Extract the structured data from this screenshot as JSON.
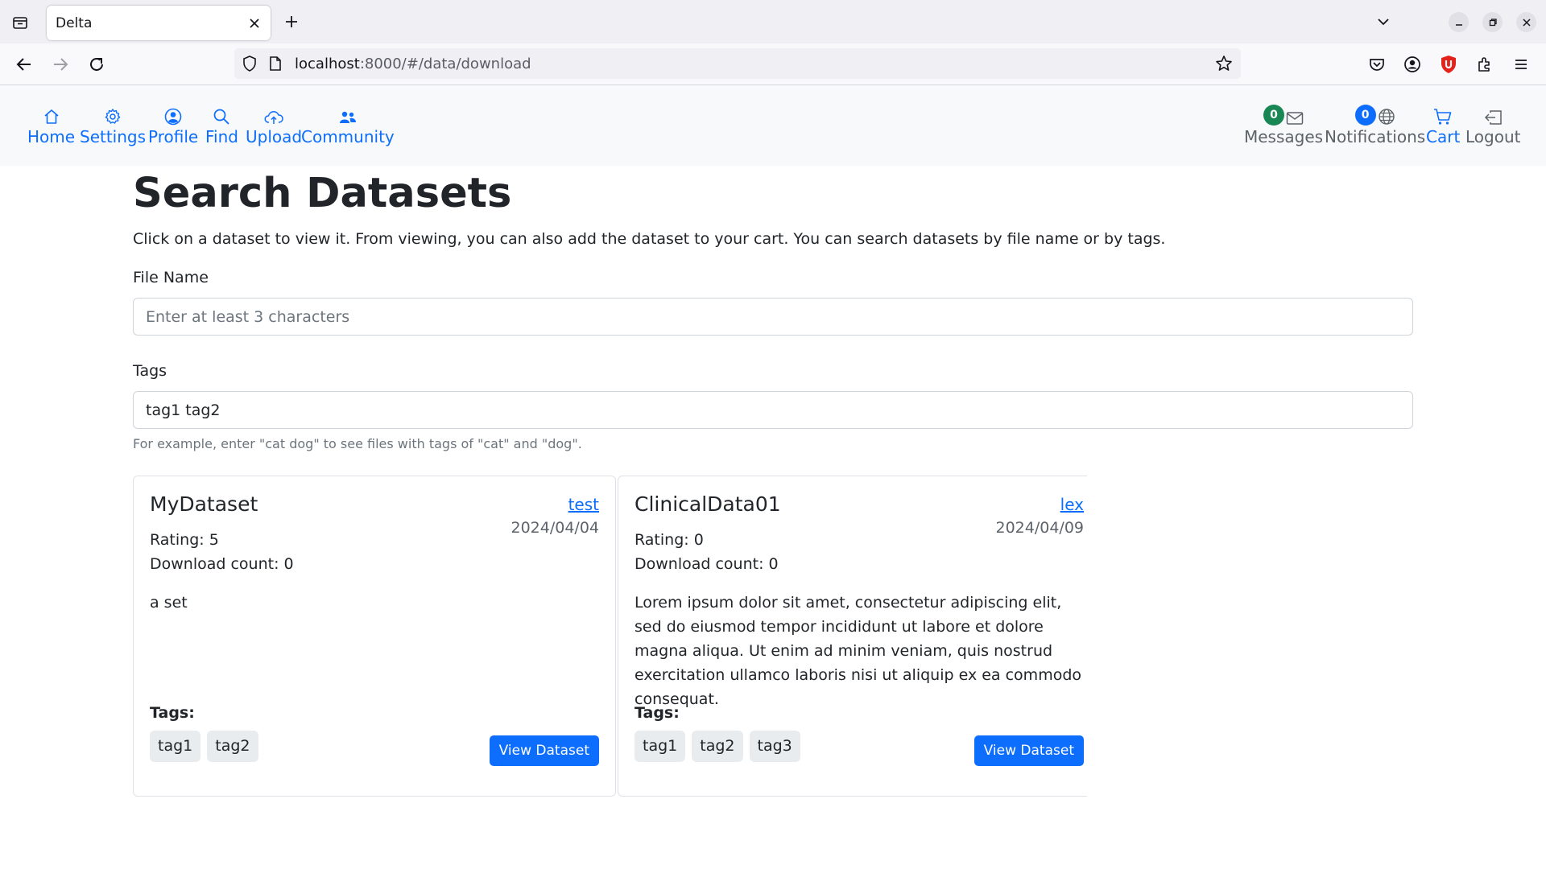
{
  "browser": {
    "tab_title": "Delta",
    "url_host": "localhost",
    "url_rest": ":8000/#/data/download"
  },
  "app_nav": {
    "left": [
      {
        "label": "Home",
        "icon": "house-icon"
      },
      {
        "label": "Settings",
        "icon": "gear-icon"
      },
      {
        "label": "Profile",
        "icon": "person-circle-icon"
      },
      {
        "label": "Find",
        "icon": "search-icon"
      },
      {
        "label": "Upload",
        "icon": "cloud-upload-icon"
      },
      {
        "label": "Community",
        "icon": "people-icon"
      }
    ],
    "right": [
      {
        "label": "Messages",
        "icon": "envelope-icon",
        "badge": "0",
        "badge_color": "#198754"
      },
      {
        "label": "Notifications",
        "icon": "globe-icon",
        "badge": "0",
        "badge_color": "#0d6efd"
      },
      {
        "label": "Cart",
        "icon": "cart-icon"
      },
      {
        "label": "Logout",
        "icon": "box-arrow-left-icon"
      }
    ]
  },
  "page": {
    "title": "Search Datasets",
    "description": "Click on a dataset to view it. From viewing, you can also add the dataset to your cart. You can search datasets by file name or by tags.",
    "file_name_label": "File Name",
    "file_name_placeholder": "Enter at least 3 characters",
    "file_name_value": "",
    "tags_label": "Tags",
    "tags_value": "tag1 tag2",
    "tags_help": "For example, enter \"cat dog\" to see files with tags of \"cat\" and \"dog\"."
  },
  "datasets": [
    {
      "name": "MyDataset",
      "owner": "test",
      "date": "2024/04/04",
      "rating": "Rating: 5",
      "downloads": "Download count: 0",
      "description": "a set",
      "tags_label": "Tags:",
      "tags": [
        "tag1",
        "tag2"
      ],
      "button": "View Dataset"
    },
    {
      "name": "ClinicalData01",
      "owner": "lex",
      "date": "2024/04/09",
      "rating": "Rating: 0",
      "downloads": "Download count: 0",
      "description": "Lorem ipsum dolor sit amet, consectetur adipiscing elit, sed do eiusmod tempor incididunt ut labore et dolore magna aliqua. Ut enim ad minim veniam, quis nostrud exercitation ullamco laboris nisi ut aliquip ex ea commodo consequat.",
      "tags_label": "Tags:",
      "tags": [
        "tag1",
        "tag2",
        "tag3"
      ],
      "button": "View Dataset"
    }
  ],
  "colors": {
    "primary": "#0d6efd",
    "success": "#198754",
    "nav_bg": "#f8f9fa",
    "muted": "#6c757d"
  }
}
